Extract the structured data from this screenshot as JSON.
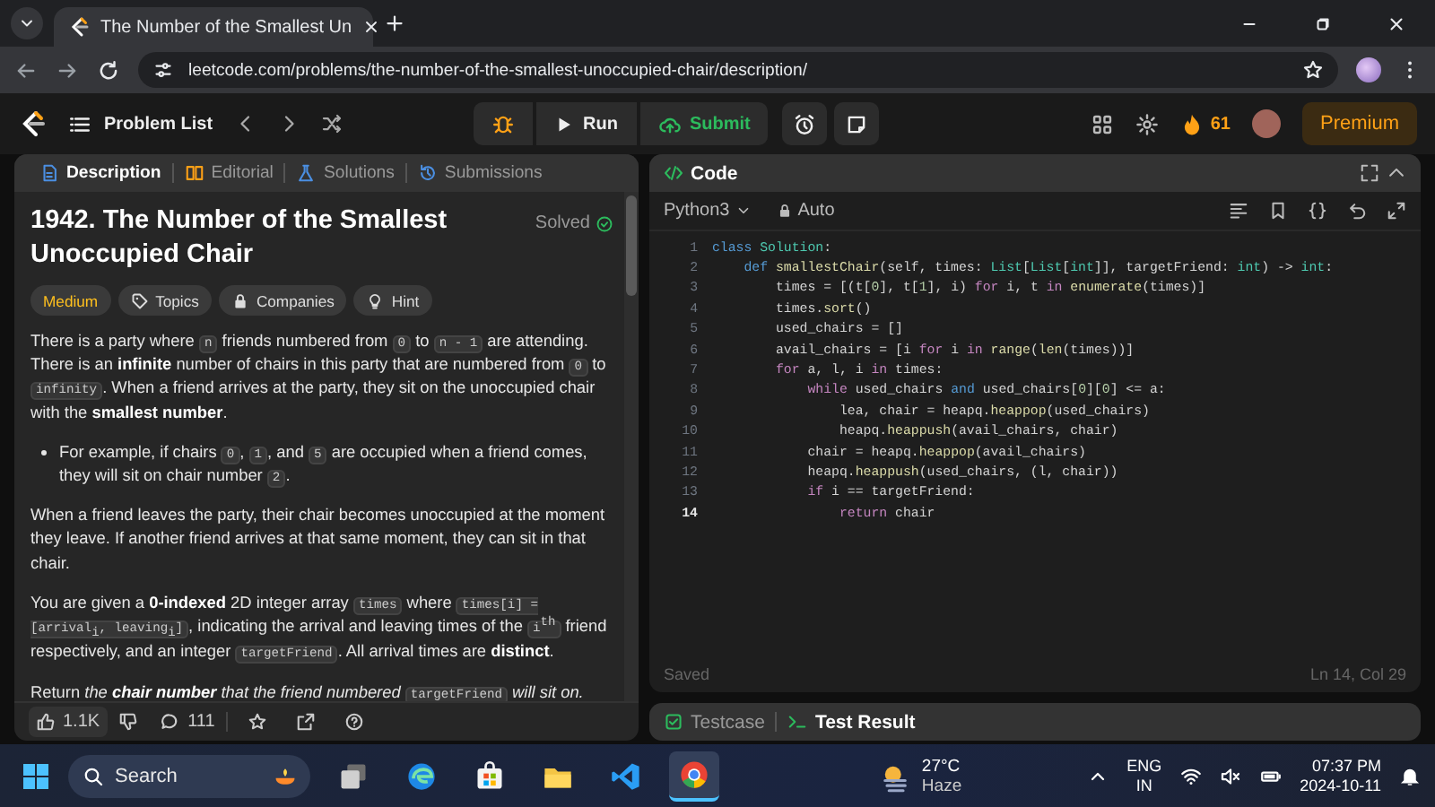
{
  "browser": {
    "tab_title": "The Number of the Smallest Un",
    "url": "leetcode.com/problems/the-number-of-the-smallest-unoccupied-chair/description/"
  },
  "nav": {
    "problem_list": "Problem List",
    "run": "Run",
    "submit": "Submit",
    "streak": "61",
    "premium": "Premium"
  },
  "description": {
    "tabs": [
      {
        "label": "Description",
        "selected": true
      },
      {
        "label": "Editorial",
        "selected": false
      },
      {
        "label": "Solutions",
        "selected": false
      },
      {
        "label": "Submissions",
        "selected": false
      }
    ],
    "title": "1942. The Number of the Smallest Unoccupied Chair",
    "status": "Solved",
    "tags": [
      {
        "kind": "difficulty",
        "label": "Medium"
      },
      {
        "kind": "topics",
        "label": "Topics"
      },
      {
        "kind": "companies",
        "label": "Companies"
      },
      {
        "kind": "hint",
        "label": "Hint"
      }
    ],
    "paragraphs": [
      {
        "kind": "paragraph",
        "segments": [
          {
            "kind": "text",
            "text": "There is a party where "
          },
          {
            "kind": "code",
            "text": "n"
          },
          {
            "kind": "text",
            "text": " friends numbered from "
          },
          {
            "kind": "code",
            "text": "0"
          },
          {
            "kind": "text",
            "text": " to "
          },
          {
            "kind": "code",
            "text": "n - 1"
          },
          {
            "kind": "text",
            "text": " are attending. There is an **infinite** number of chairs in this party that are numbered from "
          },
          {
            "kind": "code",
            "text": "0"
          },
          {
            "kind": "text",
            "text": " to "
          },
          {
            "kind": "code",
            "text": "infinity"
          },
          {
            "kind": "text",
            "text": ". When a friend arrives at the party, they sit on the unoccupied chair with the **smallest number**."
          }
        ]
      },
      {
        "kind": "bullet",
        "segments": [
          {
            "kind": "text",
            "text": "For example, if chairs "
          },
          {
            "kind": "code",
            "text": "0"
          },
          {
            "kind": "text",
            "text": ", "
          },
          {
            "kind": "code",
            "text": "1"
          },
          {
            "kind": "text",
            "text": ", and "
          },
          {
            "kind": "code",
            "text": "5"
          },
          {
            "kind": "text",
            "text": " are occupied when a friend comes, they will sit on chair number "
          },
          {
            "kind": "code",
            "text": "2"
          },
          {
            "kind": "text",
            "text": "."
          }
        ]
      },
      {
        "kind": "paragraph",
        "segments": [
          {
            "kind": "text",
            "text": "When a friend leaves the party, their chair becomes unoccupied at the moment they leave. If another friend arrives at that same moment, they can sit in that chair."
          }
        ]
      },
      {
        "kind": "paragraph",
        "segments": [
          {
            "kind": "text",
            "text": "You are given a **0-indexed** 2D integer array "
          },
          {
            "kind": "code",
            "text": "times"
          },
          {
            "kind": "text",
            "text": " where "
          },
          {
            "kind": "code",
            "text": "times[i] = [arrival$_{i}$, leaving$_{i}$]"
          },
          {
            "kind": "text",
            "text": ", indicating the arrival and leaving times of the "
          },
          {
            "kind": "code",
            "text": "i$^{th}$"
          },
          {
            "kind": "text",
            "text": " friend respectively, and an integer "
          },
          {
            "kind": "code",
            "text": "targetFriend"
          },
          {
            "kind": "text",
            "text": ". All arrival times are **distinct**."
          }
        ]
      },
      {
        "kind": "paragraph",
        "segments": [
          {
            "kind": "text",
            "text": "Return "
          },
          {
            "kind": "em",
            "text": "the **chair number** that the friend numbered "
          },
          {
            "kind": "code",
            "text": "targetFriend"
          },
          {
            "kind": "em",
            "text": " will sit on."
          }
        ]
      }
    ],
    "likes": "1.1K",
    "comments": "111"
  },
  "editor": {
    "header": "Code",
    "language": "Python3",
    "mode": "Auto",
    "lines": [
      {
        "number": "1",
        "current": false,
        "tokens": [
          {
            "kind": "kw",
            "text": "class"
          },
          {
            "kind": "cls",
            "text": " Solution"
          },
          {
            "kind": "pl",
            "text": ":"
          }
        ]
      },
      {
        "number": "2",
        "current": false,
        "tokens": [
          {
            "kind": "kw",
            "text": "    def"
          },
          {
            "kind": "fn",
            "text": " smallestChair"
          },
          {
            "kind": "pl",
            "text": "(self, times: "
          },
          {
            "kind": "cls",
            "text": "List"
          },
          {
            "kind": "pl",
            "text": "["
          },
          {
            "kind": "cls",
            "text": "List"
          },
          {
            "kind": "pl",
            "text": "["
          },
          {
            "kind": "cls",
            "text": "int"
          },
          {
            "kind": "pl",
            "text": "]], targetFriend: "
          },
          {
            "kind": "cls",
            "text": "int"
          },
          {
            "kind": "pl",
            "text": ") -> "
          },
          {
            "kind": "cls",
            "text": "int"
          },
          {
            "kind": "pl",
            "text": ":"
          }
        ]
      },
      {
        "number": "3",
        "current": false,
        "tokens": [
          {
            "kind": "pl",
            "text": "        times = [(t["
          },
          {
            "kind": "num",
            "text": "0"
          },
          {
            "kind": "pl",
            "text": "], t["
          },
          {
            "kind": "num",
            "text": "1"
          },
          {
            "kind": "pl",
            "text": "], i) "
          },
          {
            "kind": "ctl",
            "text": "for"
          },
          {
            "kind": "pl",
            "text": " i, t "
          },
          {
            "kind": "ctl",
            "text": "in"
          },
          {
            "kind": "fn",
            "text": " enumerate"
          },
          {
            "kind": "pl",
            "text": "(times)]"
          }
        ]
      },
      {
        "number": "4",
        "current": false,
        "tokens": [
          {
            "kind": "pl",
            "text": "        times."
          },
          {
            "kind": "fn",
            "text": "sort"
          },
          {
            "kind": "pl",
            "text": "()"
          }
        ]
      },
      {
        "number": "5",
        "current": false,
        "tokens": [
          {
            "kind": "pl",
            "text": "        used_chairs = []"
          }
        ]
      },
      {
        "number": "6",
        "current": false,
        "tokens": [
          {
            "kind": "pl",
            "text": "        avail_chairs = [i "
          },
          {
            "kind": "ctl",
            "text": "for"
          },
          {
            "kind": "pl",
            "text": " i "
          },
          {
            "kind": "ctl",
            "text": "in"
          },
          {
            "kind": "fn",
            "text": " range"
          },
          {
            "kind": "pl",
            "text": "("
          },
          {
            "kind": "fn",
            "text": "len"
          },
          {
            "kind": "pl",
            "text": "(times))]"
          }
        ]
      },
      {
        "number": "7",
        "current": false,
        "tokens": [
          {
            "kind": "ctl",
            "text": "        for"
          },
          {
            "kind": "pl",
            "text": " a, l, i "
          },
          {
            "kind": "ctl",
            "text": "in"
          },
          {
            "kind": "pl",
            "text": " times:"
          }
        ]
      },
      {
        "number": "8",
        "current": false,
        "tokens": [
          {
            "kind": "ctl",
            "text": "            while"
          },
          {
            "kind": "pl",
            "text": " used_chairs "
          },
          {
            "kind": "kw",
            "text": "and"
          },
          {
            "kind": "pl",
            "text": " used_chairs["
          },
          {
            "kind": "num",
            "text": "0"
          },
          {
            "kind": "pl",
            "text": "]["
          },
          {
            "kind": "num",
            "text": "0"
          },
          {
            "kind": "pl",
            "text": "] <= a:"
          }
        ]
      },
      {
        "number": "9",
        "current": false,
        "tokens": [
          {
            "kind": "pl",
            "text": "                lea, chair = heapq."
          },
          {
            "kind": "fn",
            "text": "heappop"
          },
          {
            "kind": "pl",
            "text": "(used_chairs)"
          }
        ]
      },
      {
        "number": "10",
        "current": false,
        "tokens": [
          {
            "kind": "pl",
            "text": "                heapq."
          },
          {
            "kind": "fn",
            "text": "heappush"
          },
          {
            "kind": "pl",
            "text": "(avail_chairs, chair)"
          }
        ]
      },
      {
        "number": "11",
        "current": false,
        "tokens": [
          {
            "kind": "pl",
            "text": "            chair = heapq."
          },
          {
            "kind": "fn",
            "text": "heappop"
          },
          {
            "kind": "pl",
            "text": "(avail_chairs)"
          }
        ]
      },
      {
        "number": "12",
        "current": false,
        "tokens": [
          {
            "kind": "pl",
            "text": "            heapq."
          },
          {
            "kind": "fn",
            "text": "heappush"
          },
          {
            "kind": "pl",
            "text": "(used_chairs, (l, chair))"
          }
        ]
      },
      {
        "number": "13",
        "current": false,
        "tokens": [
          {
            "kind": "ctl",
            "text": "            if"
          },
          {
            "kind": "pl",
            "text": " i == targetFriend:"
          }
        ]
      },
      {
        "number": "14",
        "current": true,
        "tokens": [
          {
            "kind": "ctl",
            "text": "                return"
          },
          {
            "kind": "pl",
            "text": " chair"
          }
        ]
      }
    ],
    "status": "Saved",
    "cursor": "Ln 14, Col 29",
    "bottom_tabs": [
      {
        "label": "Testcase",
        "selected": false
      },
      {
        "label": "Test Result",
        "selected": true
      }
    ]
  },
  "taskbar": {
    "search_placeholder": "Search",
    "temperature": "27°C",
    "weather": "Haze",
    "language": "ENG",
    "region": "IN",
    "time": "07:37 PM",
    "date": "2024-10-11"
  }
}
